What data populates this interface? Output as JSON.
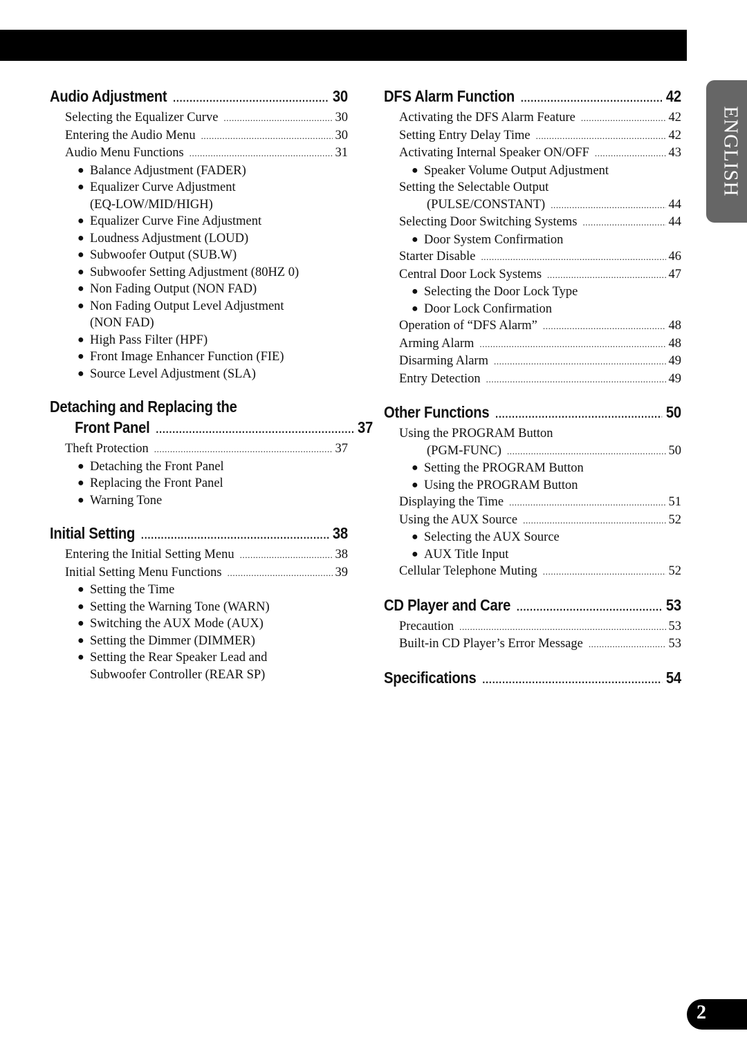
{
  "header_bar": {
    "color": "#000000"
  },
  "language_tab": {
    "label": "ENGLISH",
    "color": "#666666"
  },
  "page_number": "2",
  "left_column": {
    "audio": {
      "title": "Audio Adjustment",
      "page": "30",
      "entries": [
        {
          "text": "Selecting the Equalizer Curve",
          "page": "30"
        },
        {
          "text": "Entering the Audio Menu",
          "page": "30"
        },
        {
          "text": "Audio Menu Functions",
          "page": "31"
        }
      ],
      "bullets": [
        "Balance Adjustment (FADER)",
        "Equalizer Curve Adjustment",
        "(EQ-LOW/MID/HIGH)",
        "Equalizer Curve Fine Adjustment",
        "Loudness Adjustment (LOUD)",
        "Subwoofer Output (SUB.W)",
        "Subwoofer Setting Adjustment (80HZ 0)",
        "Non Fading Output (NON FAD)",
        "Non Fading Output Level Adjustment",
        "(NON FAD)",
        "High Pass Filter (HPF)",
        "Front Image Enhancer Function (FIE)",
        "Source Level Adjustment (SLA)"
      ]
    },
    "front_panel": {
      "title_line1": "Detaching and Replacing the",
      "title_line2": "Front Panel",
      "page": "37",
      "entries": [
        {
          "text": "Theft Protection",
          "page": "37"
        }
      ],
      "bullets": [
        "Detaching the Front Panel",
        "Replacing the Front Panel",
        "Warning Tone"
      ]
    },
    "initial": {
      "title": "Initial Setting",
      "page": "38",
      "entries": [
        {
          "text": "Entering the Initial Setting Menu",
          "page": "38"
        },
        {
          "text": "Initial Setting Menu Functions",
          "page": "39"
        }
      ],
      "bullets": [
        "Setting the Time",
        "Setting the Warning Tone (WARN)",
        "Switching the AUX Mode (AUX)",
        "Setting the Dimmer (DIMMER)",
        "Setting the Rear Speaker Lead and",
        "Subwoofer Controller (REAR SP)"
      ]
    }
  },
  "right_column": {
    "dfs": {
      "title": "DFS Alarm Function",
      "page": "42",
      "items": [
        {
          "type": "entry",
          "text": "Activating the DFS Alarm Feature",
          "page": "42"
        },
        {
          "type": "entry",
          "text": "Setting Entry Delay Time",
          "page": "42"
        },
        {
          "type": "entry",
          "text": "Activating Internal Speaker ON/OFF",
          "page": "43"
        },
        {
          "type": "bullet",
          "text": "Speaker Volume Output Adjustment"
        },
        {
          "type": "line",
          "text": "Setting the Selectable Output"
        },
        {
          "type": "entry-cont",
          "text": "(PULSE/CONSTANT)",
          "page": "44"
        },
        {
          "type": "entry",
          "text": "Selecting Door Switching Systems",
          "page": "44"
        },
        {
          "type": "bullet",
          "text": "Door System Confirmation"
        },
        {
          "type": "entry",
          "text": "Starter Disable",
          "page": "46"
        },
        {
          "type": "entry",
          "text": "Central Door Lock Systems",
          "page": "47"
        },
        {
          "type": "bullet",
          "text": "Selecting the Door Lock Type"
        },
        {
          "type": "bullet",
          "text": "Door Lock Confirmation"
        },
        {
          "type": "entry",
          "text": "Operation of “DFS Alarm”",
          "page": "48"
        },
        {
          "type": "entry",
          "text": "Arming Alarm",
          "page": "48"
        },
        {
          "type": "entry",
          "text": "Disarming Alarm",
          "page": "49"
        },
        {
          "type": "entry",
          "text": "Entry Detection",
          "page": "49"
        }
      ]
    },
    "other": {
      "title": "Other Functions",
      "page": "50",
      "items": [
        {
          "type": "line",
          "text": "Using the PROGRAM Button"
        },
        {
          "type": "entry-cont",
          "text": "(PGM-FUNC)",
          "page": "50"
        },
        {
          "type": "bullet",
          "text": "Setting the PROGRAM Button"
        },
        {
          "type": "bullet",
          "text": "Using the PROGRAM Button"
        },
        {
          "type": "entry",
          "text": "Displaying the Time",
          "page": "51"
        },
        {
          "type": "entry",
          "text": "Using the AUX Source",
          "page": "52"
        },
        {
          "type": "bullet",
          "text": "Selecting the AUX Source"
        },
        {
          "type": "bullet",
          "text": "AUX Title Input"
        },
        {
          "type": "entry",
          "text": "Cellular Telephone Muting",
          "page": "52"
        }
      ]
    },
    "cd": {
      "title": "CD Player and Care",
      "page": "53",
      "entries": [
        {
          "text": "Precaution",
          "page": "53"
        },
        {
          "text": "Built-in CD Player’s Error Message",
          "page": "53"
        }
      ]
    },
    "specs": {
      "title": "Specifications",
      "page": "54"
    }
  },
  "leader": ".........................................................................................................................................."
}
